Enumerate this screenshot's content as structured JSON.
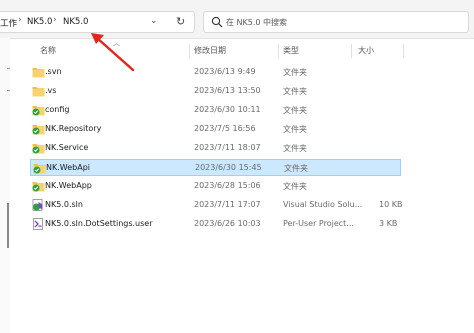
{
  "address_bar": {
    "crumbs": [
      "工作",
      "NK5.0",
      "NK5.0"
    ]
  },
  "search": {
    "placeholder": "在 NK5.0 中搜索"
  },
  "columns": {
    "name": "名称",
    "date": "修改日期",
    "type": "类型",
    "size": "大小"
  },
  "files": [
    {
      "name": ".svn",
      "date": "2023/6/13 9:49",
      "type": "文件夹",
      "size": "",
      "icon": "folder-icon"
    },
    {
      "name": ".vs",
      "date": "2023/6/13 13:50",
      "type": "文件夹",
      "size": "",
      "icon": "folder-icon"
    },
    {
      "name": "config",
      "date": "2023/6/30 10:11",
      "type": "文件夹",
      "size": "",
      "icon": "svn-folder-icon"
    },
    {
      "name": "NK.Repository",
      "date": "2023/7/5 16:56",
      "type": "文件夹",
      "size": "",
      "icon": "svn-folder-icon"
    },
    {
      "name": "NK.Service",
      "date": "2023/7/11 18:07",
      "type": "文件夹",
      "size": "",
      "icon": "svn-folder-icon"
    },
    {
      "name": "NK.WebApi",
      "date": "2023/6/30 15:45",
      "type": "文件夹",
      "size": "",
      "icon": "svn-folder-icon",
      "selected": true
    },
    {
      "name": "NK.WebApp",
      "date": "2023/6/28 15:06",
      "type": "文件夹",
      "size": "",
      "icon": "svn-folder-icon"
    },
    {
      "name": "NK5.0.sln",
      "date": "2023/7/11 17:07",
      "type": "Visual Studio Solu...",
      "size": "10 KB",
      "icon": "vs-solution-icon"
    },
    {
      "name": "NK5.0.sln.DotSettings.user",
      "date": "2023/6/26 10:03",
      "type": "Per-User Project...",
      "size": "3 KB",
      "icon": "settings-file-icon"
    }
  ],
  "colors": {
    "selection": "#cce8ff",
    "selection_border": "#99d1ff",
    "arrow": "#e0261e",
    "folder": "#f2c04a",
    "svn_green": "#2ea043"
  }
}
